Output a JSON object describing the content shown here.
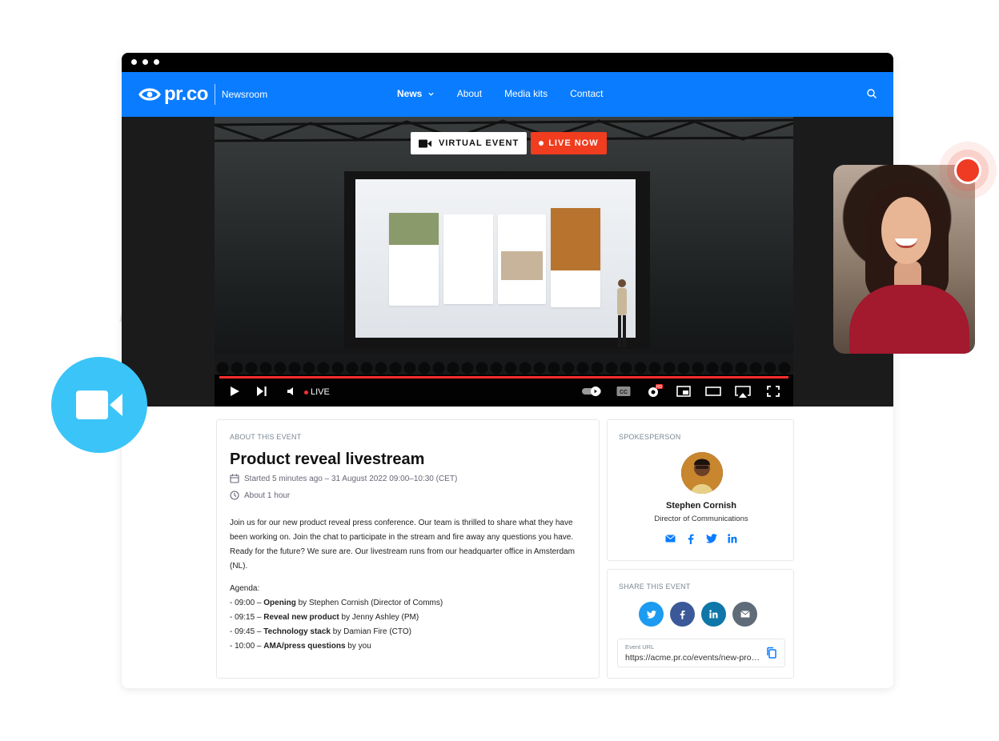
{
  "nav": {
    "brand": "pr.co",
    "section": "Newsroom",
    "items": [
      {
        "label": "News",
        "active": true,
        "dropdown": true
      },
      {
        "label": "About"
      },
      {
        "label": "Media kits"
      },
      {
        "label": "Contact"
      }
    ]
  },
  "video": {
    "badge_virtual": "VIRTUAL EVENT",
    "badge_live": "LIVE NOW",
    "live_label": "LIVE",
    "progress": 1.0,
    "hd_badge": "HD"
  },
  "about": {
    "heading": "ABOUT THIS EVENT",
    "title": "Product reveal livestream",
    "started": "Started 5 minutes ago – 31 August 2022 09:00–10:30 (CET)",
    "duration": "About 1 hour",
    "description": "Join us for our new product reveal press conference. Our team is thrilled to share what they have been working on. Join the chat to participate in the stream and fire away any questions you have. Ready for the future? We sure are. Our livestream runs from our headquarter office in Amsterdam (NL).",
    "agenda_label": "Agenda:",
    "agenda": [
      {
        "prefix": "- 09:00 – ",
        "bold": "Opening",
        "suffix": " by Stephen Cornish (Director of Comms)"
      },
      {
        "prefix": "- 09:15 – ",
        "bold": "Reveal new product",
        "suffix": " by Jenny Ashley (PM)"
      },
      {
        "prefix": "- 09:45 – ",
        "bold": "Technology stack",
        "suffix": " by Damian Fire (CTO)"
      },
      {
        "prefix": "- 10:00 – ",
        "bold": "AMA/press questions",
        "suffix": " by you"
      }
    ]
  },
  "spokesperson": {
    "heading": "SPOKESPERSON",
    "name": "Stephen Cornish",
    "role": "Director of Communications"
  },
  "share": {
    "heading": "SHARE THIS EVENT",
    "url_label": "Event URL",
    "url": "https://acme.pr.co/events/new-product-reveal-livestream"
  },
  "colors": {
    "brand_blue": "#0a7cff",
    "live_red": "#f03c1f",
    "camera_bubble": "#3bc4f8",
    "twitter": "#1d9bf0",
    "facebook": "#3b5998",
    "linkedin": "#0e76a8",
    "email": "#5f6b78"
  }
}
